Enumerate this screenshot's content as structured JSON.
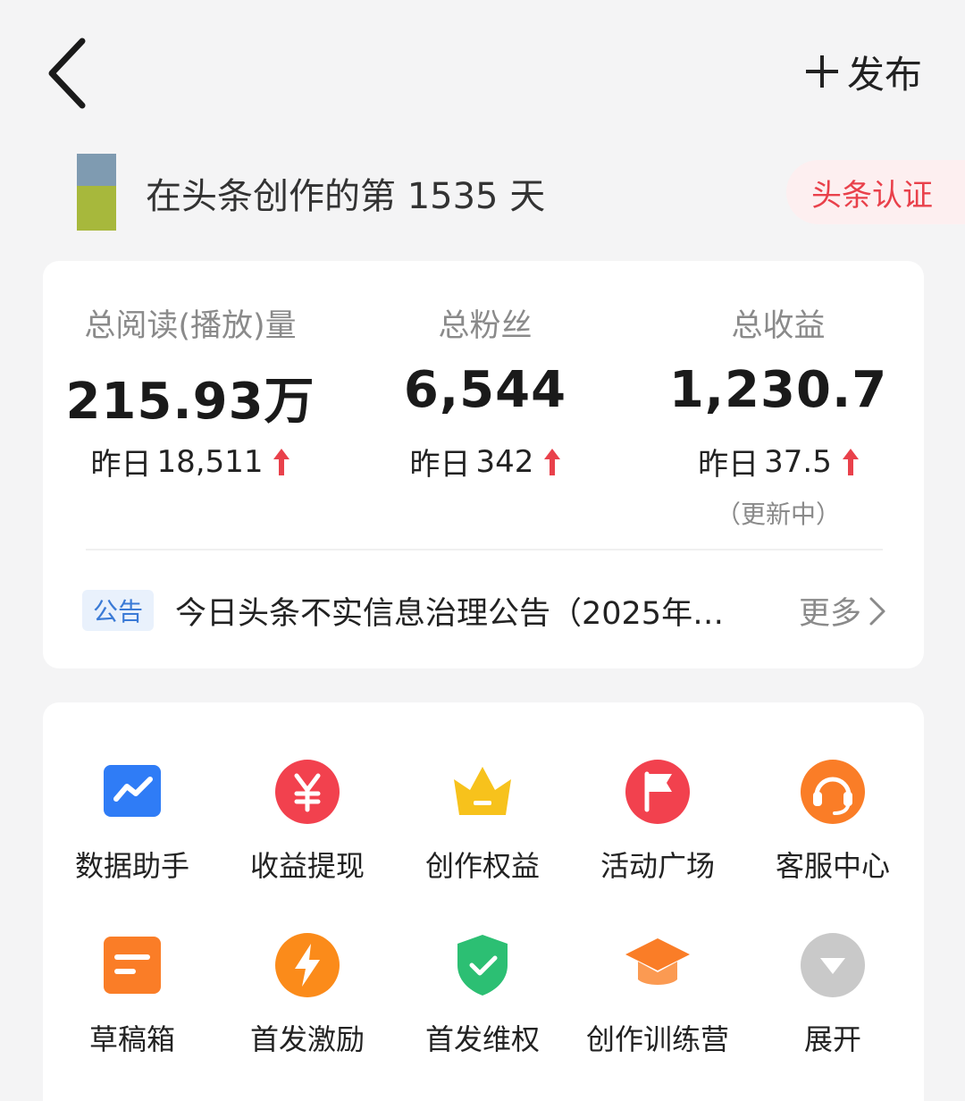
{
  "header": {
    "publish_label": "发布"
  },
  "creator": {
    "days_text": "在头条创作的第 1535 天",
    "cert_label": "头条认证"
  },
  "stats": [
    {
      "label": "总阅读(播放)量",
      "value": "215.93万",
      "yesterday_prefix": "昨日",
      "yesterday_value": "18,511",
      "trend": "up"
    },
    {
      "label": "总粉丝",
      "value": "6,544",
      "yesterday_prefix": "昨日",
      "yesterday_value": "342",
      "trend": "up"
    },
    {
      "label": "总收益",
      "value": "1,230.7",
      "yesterday_prefix": "昨日",
      "yesterday_value": "37.5",
      "trend": "up",
      "note": "（更新中）"
    }
  ],
  "notice": {
    "tag": "公告",
    "text": "今日头条不实信息治理公告（2025年…",
    "more_label": "更多"
  },
  "tools": [
    {
      "label": "数据助手",
      "icon": "chart-icon",
      "color": "#2f7cf6"
    },
    {
      "label": "收益提现",
      "icon": "yuan-icon",
      "color": "#f2414e"
    },
    {
      "label": "创作权益",
      "icon": "crown-icon",
      "color": "#f7c21c"
    },
    {
      "label": "活动广场",
      "icon": "flag-icon",
      "color": "#f2414e"
    },
    {
      "label": "客服中心",
      "icon": "headset-icon",
      "color": "#fa7d27"
    },
    {
      "label": "草稿箱",
      "icon": "draft-icon",
      "color": "#fa7d27"
    },
    {
      "label": "首发激励",
      "icon": "lightning-icon",
      "color": "#fb8b1a"
    },
    {
      "label": "首发维权",
      "icon": "shield-check-icon",
      "color": "#2cbf73"
    },
    {
      "label": "创作训练营",
      "icon": "graduation-cap-icon",
      "color": "#fa7d27"
    },
    {
      "label": "展开",
      "icon": "expand-icon",
      "color": "#c9c9c9"
    }
  ],
  "colors": {
    "accent_red": "#e9414b",
    "notice_blue": "#3a7ad6"
  }
}
